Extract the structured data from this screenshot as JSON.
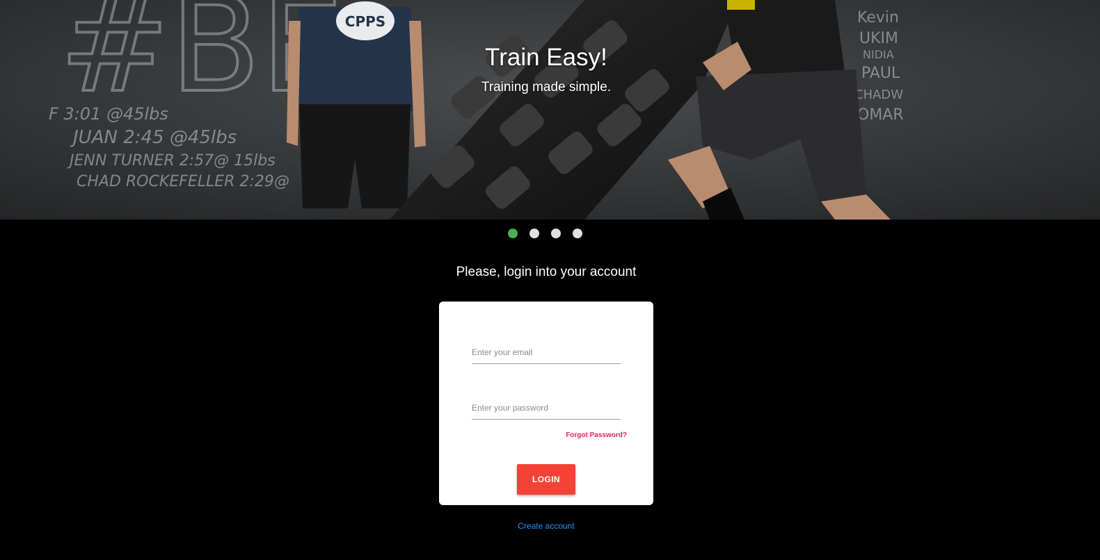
{
  "hero": {
    "title": "Train Easy!",
    "subtitle": "Training made simple.",
    "logo_text": "CPPS",
    "board_lines_left": [
      "#BE",
      "F  3:01 @45lbs",
      "JUAN  2:45 @45lbs",
      "JENN TURNER 2:57@ 15lbs",
      "CHAD ROCKEFELLER 2:29@"
    ],
    "board_lines_right": [
      "Kevin",
      "UKIM",
      "NIDIA",
      "PAUL",
      "CHADW",
      "OMAR"
    ]
  },
  "carousel": {
    "slide_count": 4,
    "active_index": 0,
    "active_color": "#4caf50",
    "inactive_color": "#e0e0e0"
  },
  "login": {
    "heading": "Please, login into your account",
    "email_placeholder": "Enter your email",
    "password_placeholder": "Enter your password",
    "forgot_label": "Forgot Password?",
    "login_label": "LOGIN",
    "create_label": "Create account"
  },
  "colors": {
    "accent": "#f44336",
    "link": "#2196f3",
    "forgot": "#e0245e"
  }
}
